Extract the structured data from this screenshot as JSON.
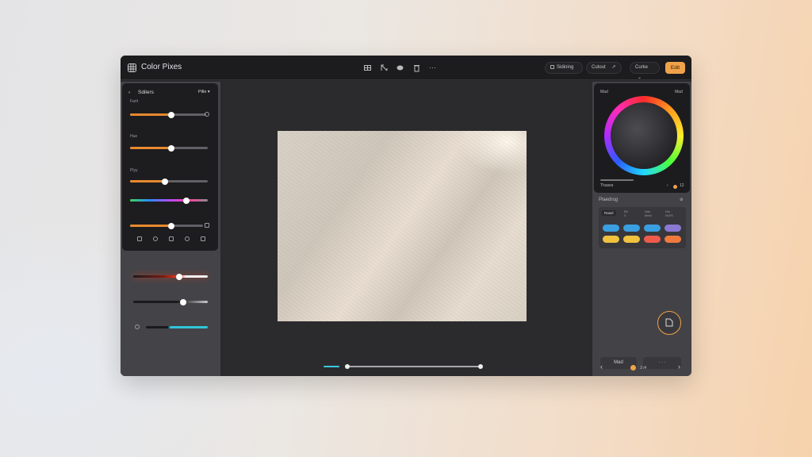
{
  "app": {
    "title": "Color Pixes"
  },
  "toolbar": {
    "icons": [
      "grid-icon",
      "crop-icon",
      "blob-icon",
      "trash-icon",
      "more-icon"
    ],
    "more_label": "···",
    "pill1_label": "Sidining",
    "pill2_label": "Cutout",
    "pill3_label": "Curke",
    "edit_label": "Edit"
  },
  "left_panel": {
    "title": "Sdilers",
    "preset": "Pille",
    "labels": [
      "Farit",
      "Hue",
      "Plyy"
    ],
    "sliders": [
      {
        "value": 0.54
      },
      {
        "value": 0.53
      },
      {
        "value": 0.45
      },
      {
        "value": 0.72
      },
      {
        "value": 0.57
      }
    ],
    "lower_sliders": [
      0.62,
      0.67,
      1.0
    ]
  },
  "canvas": {
    "scrub_value": 1.0
  },
  "right_panel": {
    "color_label": "Mad",
    "mode_label": "Mad",
    "shades_label": "Thases",
    "page_label": "12",
    "palette_title": "Plaedrug",
    "palette_tabs": [
      "Rasel",
      "B9\n3",
      "Nan\nMedi",
      "Nin\nNOIS"
    ],
    "swatches_row1": [
      "#3a9fe0",
      "#3a9fe0",
      "#3a9fe0",
      "#8a78d2"
    ],
    "swatches_row2": [
      "#f0c23e",
      "#f0c23e",
      "#f05a4a",
      "#f07a3c"
    ],
    "btn_left": "Mad",
    "btn_right": "· · ·",
    "pager": "3 /4",
    "accent": "#f0a24a"
  }
}
